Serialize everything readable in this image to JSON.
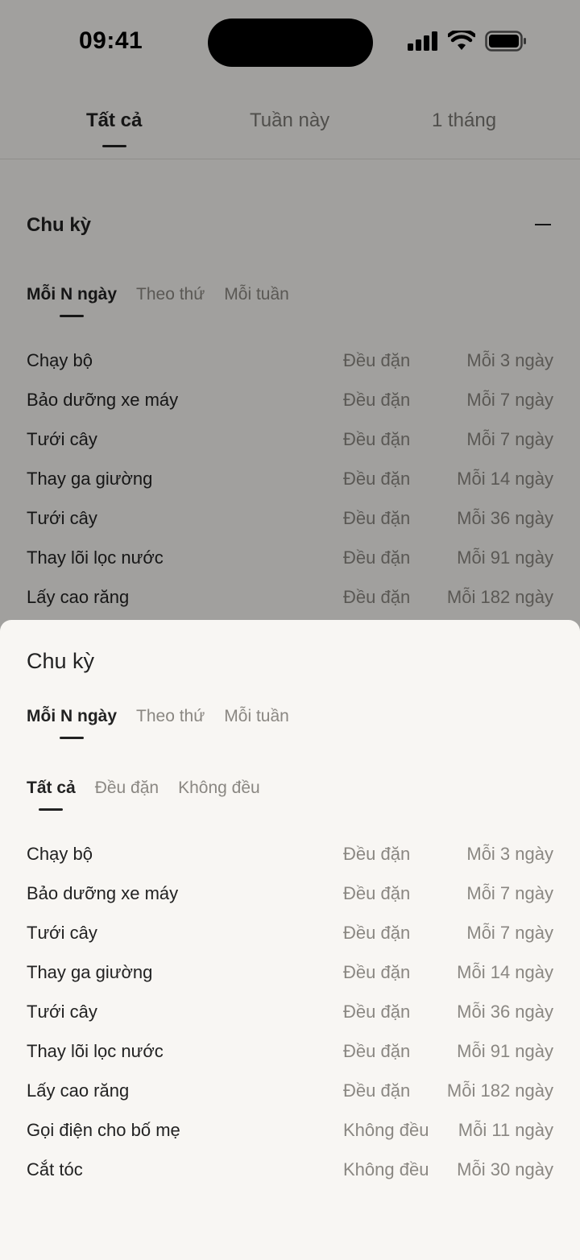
{
  "status": {
    "time": "09:41"
  },
  "top_tabs": [
    "Tất cả",
    "Tuần này",
    "1 tháng"
  ],
  "section": {
    "title": "Chu kỳ"
  },
  "mode_tabs": [
    "Mỗi N ngày",
    "Theo thứ",
    "Mỗi tuần"
  ],
  "background_list": [
    {
      "name": "Chạy bộ",
      "kind": "Đều đặn",
      "freq": "Mỗi 3 ngày"
    },
    {
      "name": "Bảo dưỡng xe máy",
      "kind": "Đều đặn",
      "freq": "Mỗi 7 ngày"
    },
    {
      "name": "Tưới cây",
      "kind": "Đều đặn",
      "freq": "Mỗi 7 ngày"
    },
    {
      "name": "Thay ga giường",
      "kind": "Đều đặn",
      "freq": "Mỗi 14 ngày"
    },
    {
      "name": "Tưới cây",
      "kind": "Đều đặn",
      "freq": "Mỗi 36 ngày"
    },
    {
      "name": "Thay lõi lọc nước",
      "kind": "Đều đặn",
      "freq": "Mỗi 91 ngày"
    },
    {
      "name": "Lấy cao răng",
      "kind": "Đều đặn",
      "freq": "Mỗi 182 ngày"
    }
  ],
  "sheet": {
    "title": "Chu kỳ",
    "mode_tabs": [
      "Mỗi N ngày",
      "Theo thứ",
      "Mỗi tuần"
    ],
    "filter_tabs": [
      "Tất cả",
      "Đều đặn",
      "Không đều"
    ],
    "items": [
      {
        "name": "Chạy bộ",
        "kind": "Đều đặn",
        "freq": "Mỗi 3 ngày"
      },
      {
        "name": "Bảo dưỡng xe máy",
        "kind": "Đều đặn",
        "freq": "Mỗi 7 ngày"
      },
      {
        "name": "Tưới cây",
        "kind": "Đều đặn",
        "freq": "Mỗi 7 ngày"
      },
      {
        "name": "Thay ga giường",
        "kind": "Đều đặn",
        "freq": "Mỗi 14 ngày"
      },
      {
        "name": "Tưới cây",
        "kind": "Đều đặn",
        "freq": "Mỗi 36 ngày"
      },
      {
        "name": "Thay lõi lọc nước",
        "kind": "Đều đặn",
        "freq": "Mỗi 91 ngày"
      },
      {
        "name": "Lấy cao răng",
        "kind": "Đều đặn",
        "freq": "Mỗi 182 ngày"
      },
      {
        "name": "Gọi điện cho bố mẹ",
        "kind": "Không đều",
        "freq": "Mỗi 11 ngày"
      },
      {
        "name": "Cắt tóc",
        "kind": "Không đều",
        "freq": "Mỗi 30 ngày"
      }
    ]
  }
}
